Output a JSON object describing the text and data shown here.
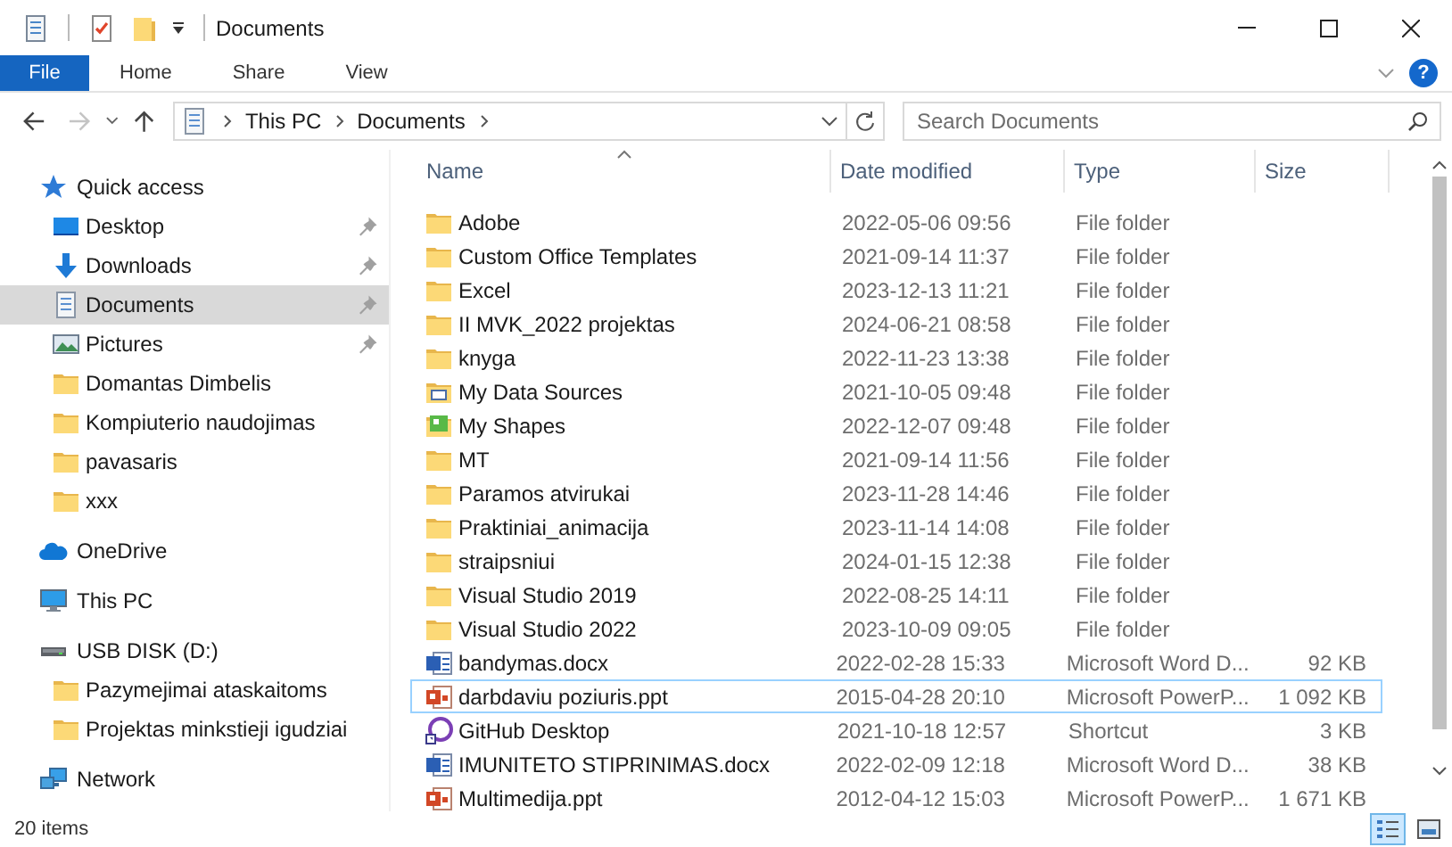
{
  "window": {
    "title": "Documents"
  },
  "ribbon": {
    "tabs": [
      {
        "label": "File",
        "kind": "file",
        "selected": false
      },
      {
        "label": "Home",
        "kind": "tab",
        "selected": false
      },
      {
        "label": "Share",
        "kind": "tab",
        "selected": false
      },
      {
        "label": "View",
        "kind": "tab",
        "selected": false
      }
    ],
    "help": "?"
  },
  "nav": {
    "back_disabled": false,
    "forward_disabled": true
  },
  "breadcrumb": [
    "This PC",
    "Documents"
  ],
  "search": {
    "placeholder": "Search Documents"
  },
  "sidebar": [
    {
      "label": "Quick access",
      "kind": "star",
      "selected": false,
      "children": [
        {
          "label": "Desktop",
          "kind": "desktop",
          "pinned": true,
          "selected": false
        },
        {
          "label": "Downloads",
          "kind": "download",
          "pinned": true,
          "selected": false
        },
        {
          "label": "Documents",
          "kind": "documents",
          "pinned": true,
          "selected": true
        },
        {
          "label": "Pictures",
          "kind": "pictures",
          "pinned": true,
          "selected": false
        },
        {
          "label": "Domantas Dimbelis",
          "kind": "folder",
          "pinned": false,
          "selected": false
        },
        {
          "label": "Kompiuterio naudojimas",
          "kind": "folder",
          "pinned": false,
          "selected": false
        },
        {
          "label": "pavasaris",
          "kind": "folder",
          "pinned": false,
          "selected": false
        },
        {
          "label": "xxx",
          "kind": "folder",
          "pinned": false,
          "selected": false
        }
      ]
    },
    {
      "label": "OneDrive",
      "kind": "cloud",
      "selected": false
    },
    {
      "label": "This PC",
      "kind": "pc",
      "selected": false
    },
    {
      "label": "USB DISK (D:)",
      "kind": "drive",
      "selected": false,
      "children": [
        {
          "label": "Pazymejimai ataskaitoms",
          "kind": "folder",
          "pinned": false,
          "selected": false
        },
        {
          "label": "Projektas minkstieji igudziai",
          "kind": "folder",
          "pinned": false,
          "selected": false
        }
      ]
    },
    {
      "label": "Network",
      "kind": "network",
      "selected": false
    }
  ],
  "table": {
    "columns": [
      {
        "label": "Name",
        "sorted": true
      },
      {
        "label": "Date modified",
        "sorted": false
      },
      {
        "label": "Type",
        "sorted": false
      },
      {
        "label": "Size",
        "sorted": false
      }
    ],
    "rows": [
      {
        "name": "Adobe",
        "kind": "folder",
        "date": "2022-05-06 09:56",
        "type": "File folder",
        "focused": false
      },
      {
        "name": "Custom Office Templates",
        "kind": "folder",
        "date": "2021-09-14 11:37",
        "type": "File folder",
        "focused": false
      },
      {
        "name": "Excel",
        "kind": "folder",
        "date": "2023-12-13 11:21",
        "type": "File folder",
        "focused": false
      },
      {
        "name": "II MVK_2022 projektas",
        "kind": "folder",
        "date": "2024-06-21 08:58",
        "type": "File folder",
        "focused": false
      },
      {
        "name": "knyga",
        "kind": "folder",
        "date": "2022-11-23 13:38",
        "type": "File folder",
        "focused": false
      },
      {
        "name": "My Data Sources",
        "kind": "datasources",
        "date": "2021-10-05 09:48",
        "type": "File folder",
        "focused": false
      },
      {
        "name": "My Shapes",
        "kind": "shapes",
        "date": "2022-12-07 09:48",
        "type": "File folder",
        "focused": false
      },
      {
        "name": "MT",
        "kind": "folder",
        "date": "2021-09-14 11:56",
        "type": "File folder",
        "focused": false
      },
      {
        "name": "Paramos atvirukai",
        "kind": "folder",
        "date": "2023-11-28 14:46",
        "type": "File folder",
        "focused": false
      },
      {
        "name": "Praktiniai_animacija",
        "kind": "folder",
        "date": "2023-11-14 14:08",
        "type": "File folder",
        "focused": false
      },
      {
        "name": "straipsniui",
        "kind": "folder",
        "date": "2024-01-15 12:38",
        "type": "File folder",
        "focused": false
      },
      {
        "name": "Visual Studio 2019",
        "kind": "folder",
        "date": "2022-08-25 14:11",
        "type": "File folder",
        "focused": false
      },
      {
        "name": "Visual Studio 2022",
        "kind": "folder",
        "date": "2023-10-09 09:05",
        "type": "File folder",
        "focused": false
      },
      {
        "name": "bandymas.docx",
        "kind": "word",
        "date": "2022-02-28 15:33",
        "type": "Microsoft Word D...",
        "size": "92 KB",
        "focused": false
      },
      {
        "name": "darbdaviu poziuris.ppt",
        "kind": "ppt",
        "date": "2015-04-28 20:10",
        "type": "Microsoft PowerP...",
        "size": "1 092 KB",
        "focused": true
      },
      {
        "name": "GitHub Desktop",
        "kind": "shortcut",
        "date": "2021-10-18 12:57",
        "type": "Shortcut",
        "size": "3 KB",
        "focused": false
      },
      {
        "name": "IMUNITETO STIPRINIMAS.docx",
        "kind": "word",
        "date": "2022-02-09 12:18",
        "type": "Microsoft Word D...",
        "size": "38 KB",
        "focused": false
      },
      {
        "name": "Multimedija.ppt",
        "kind": "ppt",
        "date": "2012-04-12 15:03",
        "type": "Microsoft PowerP...",
        "size": "1 671 KB",
        "focused": false
      }
    ]
  },
  "status_bar": {
    "items": "20 items"
  },
  "view_buttons": [
    {
      "kind": "details",
      "selected": true
    },
    {
      "kind": "large",
      "selected": false
    }
  ]
}
